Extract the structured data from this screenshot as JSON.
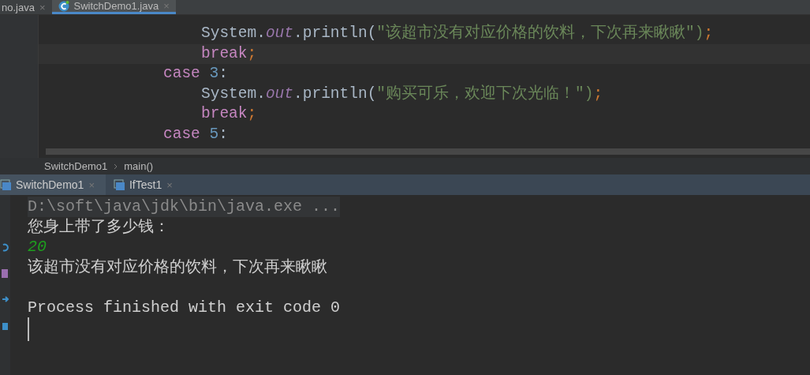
{
  "editor_tabs": [
    {
      "label": "no.java",
      "close": "×",
      "selected": false,
      "icon": false
    },
    {
      "label": "SwitchDemo1.java",
      "close": "×",
      "selected": true,
      "icon": true
    }
  ],
  "code_lines": [
    {
      "indented": true,
      "tokens": [
        {
          "kind": "plain",
          "text": "System."
        },
        {
          "kind": "field",
          "text": "out"
        },
        {
          "kind": "plain",
          "text": ".println("
        },
        {
          "kind": "string",
          "text": "\"该超市没有对应价格的饮料，下次再来瞅瞅\")"
        },
        {
          "kind": "punct",
          "text": ";"
        }
      ]
    },
    {
      "indented": true,
      "tokens": [
        {
          "kind": "keyword",
          "text": "break"
        },
        {
          "kind": "punct",
          "text": ";"
        }
      ]
    },
    {
      "indented": false,
      "tokens": [
        {
          "kind": "keyword",
          "text": "case"
        },
        {
          "kind": "space"
        },
        {
          "kind": "number",
          "text": "3"
        },
        {
          "kind": "plain",
          "text": ":"
        }
      ]
    },
    {
      "indented": true,
      "tokens": [
        {
          "kind": "plain",
          "text": "System."
        },
        {
          "kind": "field",
          "text": "out"
        },
        {
          "kind": "plain",
          "text": ".println("
        },
        {
          "kind": "string",
          "text": "\"购买可乐，欢迎下次光临！\")"
        },
        {
          "kind": "punct",
          "text": ";"
        }
      ]
    },
    {
      "indented": true,
      "tokens": [
        {
          "kind": "keyword",
          "text": "break"
        },
        {
          "kind": "punct",
          "text": ";"
        }
      ]
    },
    {
      "indented": false,
      "tokens": [
        {
          "kind": "keyword",
          "text": "case"
        },
        {
          "kind": "space"
        },
        {
          "kind": "number",
          "text": "5"
        },
        {
          "kind": "plain",
          "text": ":"
        }
      ]
    }
  ],
  "breadcrumb": [
    "SwitchDemo1",
    "main()"
  ],
  "run_tabs": [
    {
      "label": "SwitchDemo1",
      "close": "×",
      "selected": true
    },
    {
      "label": "IfTest1",
      "close": "×",
      "selected": false
    }
  ],
  "console_lines": [
    {
      "kind": "command",
      "text": "D:\\soft\\java\\jdk\\bin\\java.exe ..."
    },
    {
      "kind": "output",
      "text": "您身上带了多少钱："
    },
    {
      "kind": "input",
      "text": "20"
    },
    {
      "kind": "output",
      "text": "该超市没有对应价格的饮料，下次再来瞅瞅"
    },
    {
      "kind": "blank"
    },
    {
      "kind": "output",
      "text": "Process finished with exit code 0"
    },
    {
      "kind": "caret"
    }
  ]
}
